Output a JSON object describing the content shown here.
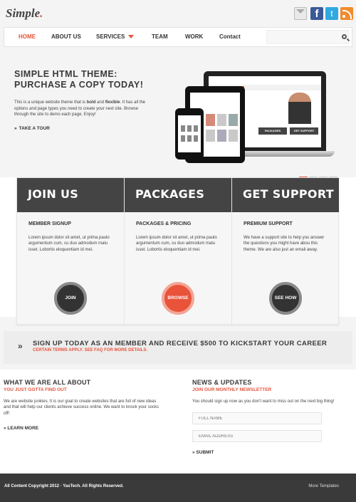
{
  "header": {
    "logo_text": "Simple",
    "logo_dot": ".",
    "social": [
      "mail-icon",
      "facebook-icon",
      "twitter-icon",
      "rss-icon"
    ]
  },
  "nav": {
    "items": [
      "HOME",
      "ABOUT US",
      "SERVICES",
      "TEAM",
      "WORK",
      "Contact"
    ],
    "active": "HOME",
    "search_placeholder": ""
  },
  "hero": {
    "title_line1": "SIMPLE HTML THEME:",
    "title_line2": "PURCHASE A COPY TODAY!",
    "text_before_bold": "This is a unique website theme that is ",
    "text_bold1": "bold",
    "text_and": " and ",
    "text_bold2": "flexible",
    "text_after": ". It has all the options and page types you need to create your next site. Browse through the site to demo each page. Enjoy!",
    "tour_label": "TAKE A TOUR",
    "slides": 4,
    "active_slide": 1
  },
  "mockup": {
    "btn_packages": "PACKAGES",
    "btn_support": "GET SUPPORT",
    "nav_items": [
      "HOME",
      "TEAM",
      "WORK",
      "CONTACT"
    ]
  },
  "features": [
    {
      "heading": "JOIN US",
      "subtitle": "MEMBER SIGNUP",
      "text": "Lorem ipsum dolor sit amet, ut prima paulo argumentum cum, cu duo admodum malu isset. Lobortis eloquentiam id mei.",
      "button": "JOIN"
    },
    {
      "heading": "PACKAGES",
      "subtitle": "PACKAGES & PRICING",
      "text": "Lorem ipsum dolor sit amet, ut prima paulo argumentum cum, cu duo admodum malu isset. Lobortis eloquentiam id mei.",
      "button": "BROWSE"
    },
    {
      "heading": "GET SUPPORT",
      "subtitle": "PREMIUM SUPPORT",
      "text": "We have a support site to help you answer the questions you might have abou this theme. We are also just an email away.",
      "button": "SEE HOW"
    }
  ],
  "signup": {
    "title": "SIGN UP TODAY AS AN MEMBER AND RECEIVE $500 TO KICKSTART YOUR CAREER",
    "note": "CERTAIN TERMS APPLY. SEE FAQ FOR MORE DETAILS."
  },
  "about": {
    "title": "WHAT WE ARE ALL ABOUT",
    "subtitle": "YOU JUST GOTTA FIND OUT",
    "text": "We are website junkies. It is our goal to create websites that are full of new ideas and that will help our clients achieve success online. We want to knock your socks off!",
    "link": "LEARN MORE"
  },
  "news": {
    "title": "NEWS & UPDATES",
    "subtitle": "JOIN OUR MONTHLY NEWSLETTER",
    "text": "You should sign up now as you don't want to miss out on the next big thing!",
    "name_placeholder": "FULL NAME",
    "email_placeholder": "EMAIL ADDRESS",
    "submit": "SUBMIT"
  },
  "footer": {
    "copyright": "All Content Copyright 2012 · YasTech. All Rights Reserved.",
    "right_text": "More Templates"
  },
  "colors": {
    "accent": "#e8533a",
    "dark": "#444444",
    "background": "#f4f4f4"
  }
}
